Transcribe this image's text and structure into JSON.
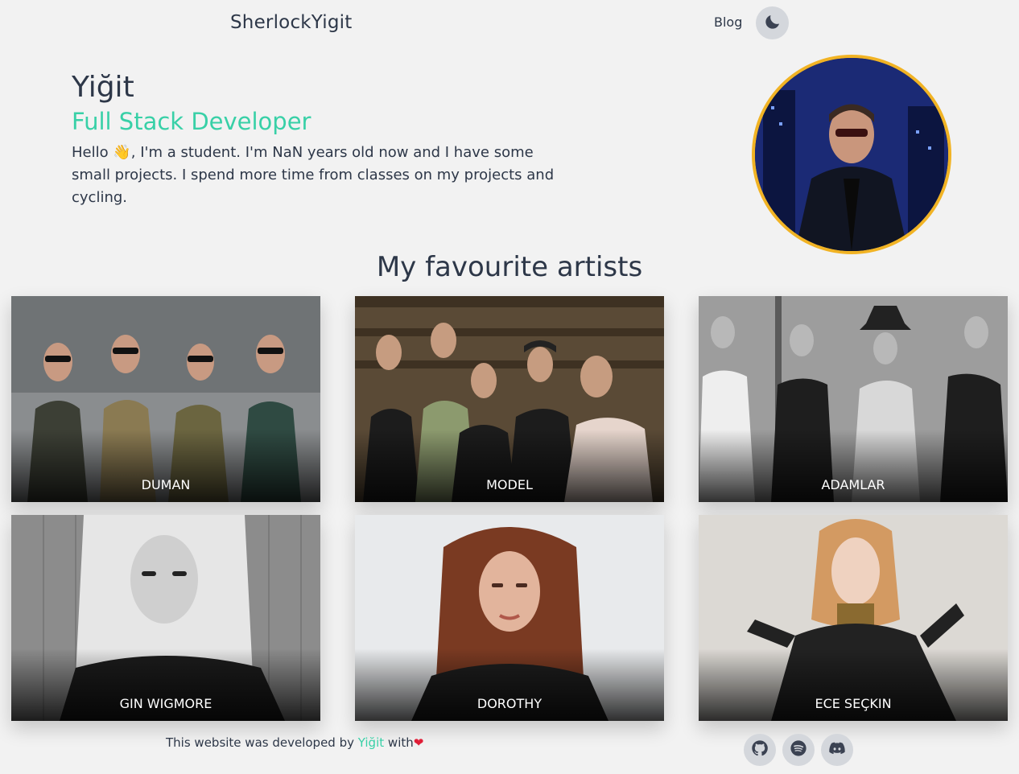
{
  "header": {
    "brand": "SherlockYigit",
    "nav_blog": "Blog",
    "theme_toggle_icon": "moon-icon"
  },
  "intro": {
    "name": "Yiğit",
    "role": "Full Stack Developer",
    "bio": "Hello 👋, I'm a student. I'm NaN years old now and I have some small projects. I spend more time from classes on my projects and cycling."
  },
  "artists": {
    "title": "My favourite artists",
    "items": [
      {
        "name": "DUMAN"
      },
      {
        "name": "MODEL"
      },
      {
        "name": "ADAMLAR"
      },
      {
        "name": "GIN WIGMORE"
      },
      {
        "name": "DOROTHY"
      },
      {
        "name": "ECE SEÇKIN"
      }
    ]
  },
  "footer": {
    "credit_prefix": "This website was developed by",
    "author": "Yiğit",
    "credit_suffix": "with",
    "heart": "❤",
    "social": [
      "github-icon",
      "spotify-icon",
      "discord-icon"
    ]
  },
  "colors": {
    "accent": "#38d0a7",
    "avatar_ring": "#f1b324",
    "background": "#f2f2f2",
    "heart": "#e01e37"
  }
}
